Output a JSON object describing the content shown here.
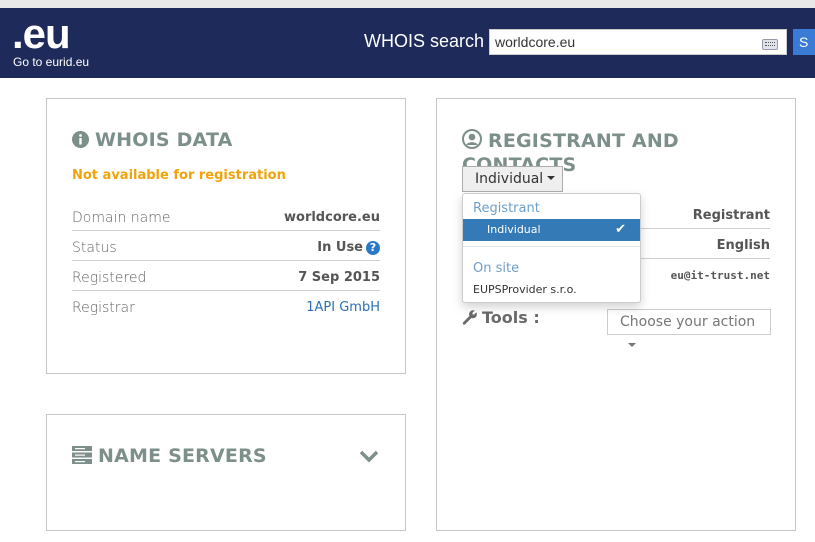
{
  "header": {
    "logo": ".eu",
    "logo_link": "Go to eurid.eu",
    "search_label": "WHOIS search",
    "search_value": "worldcore.eu",
    "search_button": "S",
    "bg_color": "#1e2b5a"
  },
  "whois": {
    "title": "WHOIS DATA",
    "availability": "Not available for registration",
    "rows": [
      {
        "label": "Domain name",
        "value": "worldcore.eu"
      },
      {
        "label": "Status",
        "value": "In Use",
        "help": "?"
      },
      {
        "label": "Registered",
        "value": "7 Sep 2015"
      },
      {
        "label": "Registrar",
        "value": "1API GmbH"
      }
    ]
  },
  "nameservers": {
    "title": "NAME SERVERS"
  },
  "registrant": {
    "title": "REGISTRANT AND CONTACTS",
    "selected": "Individual",
    "dropdown": {
      "group1": "Registrant",
      "item1": "Individual",
      "group2": "On site",
      "item2": "EUPSProvider s.r.o."
    },
    "rows": [
      {
        "value": "Registrant"
      },
      {
        "value": "English"
      },
      {
        "value": "eu@it-trust.net"
      }
    ],
    "tools_label": "Tools :",
    "action_label": "Choose your action"
  },
  "colors": {
    "accent": "#337ab7",
    "warning": "#f0a30a",
    "title": "#7c8f8a",
    "link": "#2a6fb5"
  }
}
